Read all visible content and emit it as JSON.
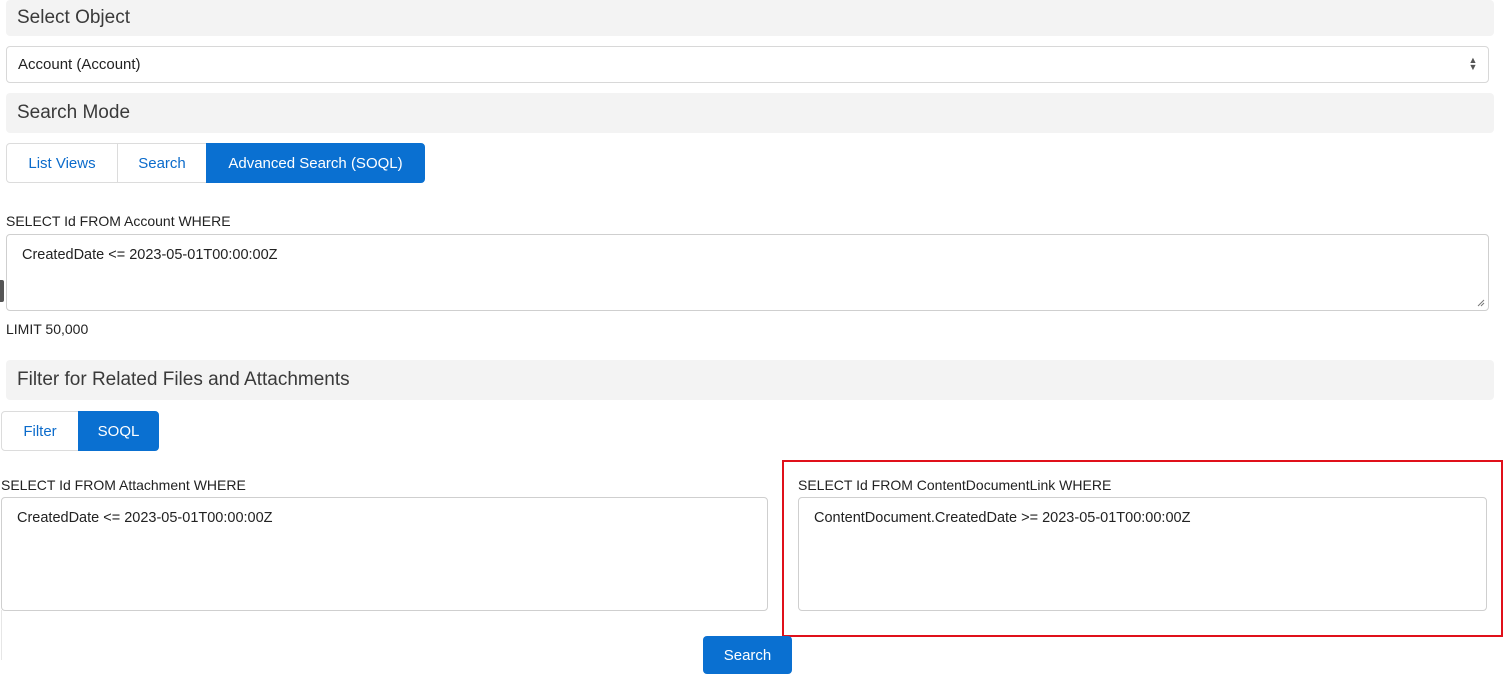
{
  "select_object": {
    "header": "Select Object",
    "selected": "Account (Account)"
  },
  "search_mode": {
    "header": "Search Mode",
    "tabs": [
      {
        "label": "List Views",
        "active": false
      },
      {
        "label": "Search",
        "active": false
      },
      {
        "label": "Advanced Search (SOQL)",
        "active": true
      }
    ]
  },
  "advanced": {
    "prefix": "SELECT Id FROM Account WHERE",
    "where_value": "CreatedDate <= 2023-05-01T00:00:00Z",
    "limit": "LIMIT 50,000"
  },
  "related_filter": {
    "header": "Filter for Related Files and Attachments",
    "tabs": [
      {
        "label": "Filter",
        "active": false
      },
      {
        "label": "SOQL",
        "active": true
      }
    ],
    "attachment": {
      "prefix": "SELECT Id FROM Attachment WHERE",
      "where_value": "CreatedDate <= 2023-05-01T00:00:00Z"
    },
    "content_document_link": {
      "prefix": "SELECT Id FROM ContentDocumentLink WHERE",
      "where_value": "ContentDocument.CreatedDate >= 2023-05-01T00:00:00Z"
    }
  },
  "search_button": "Search",
  "colors": {
    "accent": "#0a70d1",
    "highlight": "#e0101a",
    "header_bg": "#f3f3f3"
  }
}
